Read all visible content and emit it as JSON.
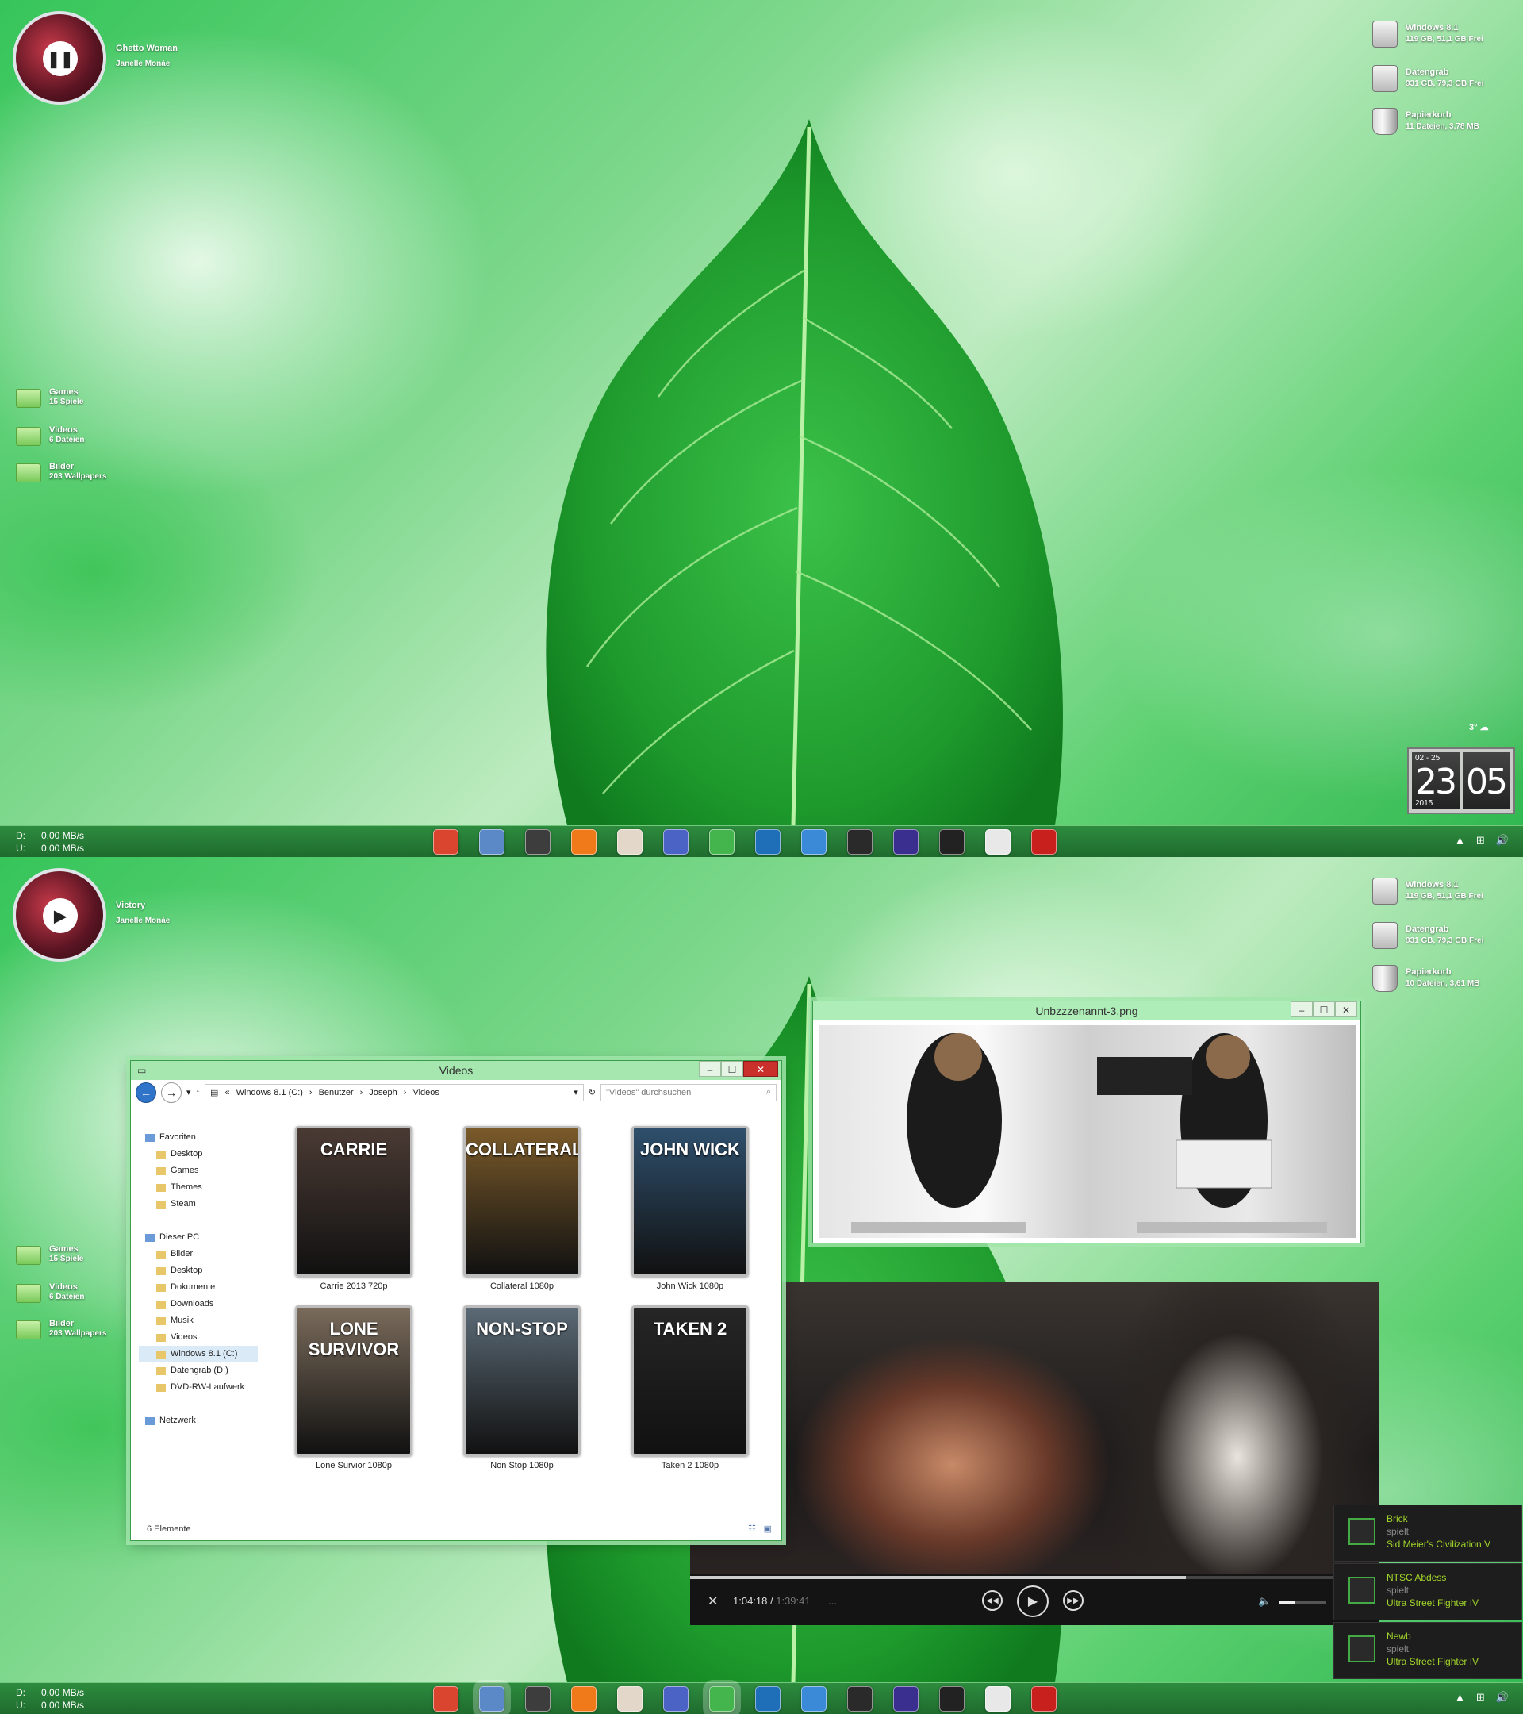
{
  "screen1": {
    "player": {
      "title": "Ghetto Woman",
      "artist": "Janelle Monáe",
      "state_icon": "pause-icon"
    },
    "drives": [
      {
        "name": "Windows 8.1",
        "info": "119 GB, 51,1 GB Frei"
      },
      {
        "name": "Datengrab",
        "info": "931 GB, 79,3 GB Frei"
      },
      {
        "name": "Papierkorb",
        "info": "11 Dateien, 3,78 MB"
      }
    ],
    "folders": [
      {
        "name": "Games",
        "info": "15 Spiele"
      },
      {
        "name": "Videos",
        "info": "6 Dateien"
      },
      {
        "name": "Bilder",
        "info": "203 Wallpapers"
      }
    ],
    "weather": "3°",
    "clock": {
      "date": "02 - 25",
      "year": "2015",
      "hour": "23",
      "minute": "05"
    },
    "net": {
      "d_label": "D:",
      "d_value": "0,00 MB/s",
      "u_label": "U:",
      "u_value": "0,00 MB/s"
    }
  },
  "screen2": {
    "player": {
      "title": "Victory",
      "artist": "Janelle Monáe",
      "state_icon": "play-icon"
    },
    "drives": [
      {
        "name": "Windows 8.1",
        "info": "119 GB, 51,1 GB Frei"
      },
      {
        "name": "Datengrab",
        "info": "931 GB, 79,3 GB Frei"
      },
      {
        "name": "Papierkorb",
        "info": "10 Dateien, 3,61 MB"
      }
    ],
    "folders": [
      {
        "name": "Games",
        "info": "15 Spiele"
      },
      {
        "name": "Videos",
        "info": "6 Dateien"
      },
      {
        "name": "Bilder",
        "info": "203 Wallpapers"
      }
    ],
    "net": {
      "d_label": "D:",
      "d_value": "0,00 MB/s",
      "u_label": "U:",
      "u_value": "0,00 MB/s"
    },
    "explorer": {
      "title": "Videos",
      "path": [
        "Windows 8.1 (C:)",
        "Benutzer",
        "Joseph",
        "Videos"
      ],
      "search_placeholder": "\"Videos\" durchsuchen",
      "nav": [
        {
          "label": "Favoriten",
          "level": 0
        },
        {
          "label": "Desktop",
          "level": 1
        },
        {
          "label": "Games",
          "level": 1
        },
        {
          "label": "Themes",
          "level": 1
        },
        {
          "label": "Steam",
          "level": 1
        },
        {
          "label": "",
          "level": 0
        },
        {
          "label": "Dieser PC",
          "level": 0
        },
        {
          "label": "Bilder",
          "level": 1
        },
        {
          "label": "Desktop",
          "level": 1
        },
        {
          "label": "Dokumente",
          "level": 1
        },
        {
          "label": "Downloads",
          "level": 1
        },
        {
          "label": "Musik",
          "level": 1
        },
        {
          "label": "Videos",
          "level": 1
        },
        {
          "label": "Windows 8.1 (C:)",
          "level": 1
        },
        {
          "label": "Datengrab (D:)",
          "level": 1
        },
        {
          "label": "DVD-RW-Laufwerk",
          "level": 1
        },
        {
          "label": "",
          "level": 0
        },
        {
          "label": "Netzwerk",
          "level": 0
        }
      ],
      "items": [
        {
          "caption": "Carrie 2013 720p",
          "cover_title": "CARRIE",
          "color": "#4a3a34"
        },
        {
          "caption": "Collateral 1080p",
          "cover_title": "COLLATERAL",
          "color": "#7a5a2a"
        },
        {
          "caption": "John Wick 1080p",
          "cover_title": "JOHN WICK",
          "color": "#2e4f6c"
        },
        {
          "caption": "Lone Survior 1080p",
          "cover_title": "LONE SURVIVOR",
          "color": "#7a6b5b"
        },
        {
          "caption": "Non Stop 1080p",
          "cover_title": "NON-STOP",
          "color": "#5b6a76"
        },
        {
          "caption": "Taken 2 1080p",
          "cover_title": "TAKEN 2",
          "color": "#262626"
        }
      ],
      "status": "6 Elemente"
    },
    "viewer": {
      "title": "Unbzzzenannt-3.png"
    },
    "video": {
      "elapsed": "1:04:18",
      "total": "1:39:41",
      "more": "...",
      "progress": 0.72,
      "volume": 0.35
    },
    "notifications": [
      {
        "name": "Brick",
        "verb": "spielt",
        "game": "Sid Meier's Civilization V"
      },
      {
        "name": "NTSC Abdess",
        "verb": "spielt",
        "game": "Ultra Street Fighter IV"
      },
      {
        "name": "Newb",
        "verb": "spielt",
        "game": "Ultra Street Fighter IV"
      }
    ]
  },
  "dock": [
    {
      "name": "chrome",
      "color": "#d9452f"
    },
    {
      "name": "explorer",
      "color": "#5b89c8"
    },
    {
      "name": "steam",
      "color": "#3d3d3d"
    },
    {
      "name": "origin",
      "color": "#f07a1a"
    },
    {
      "name": "feather",
      "color": "#e2d7c9"
    },
    {
      "name": "picasa",
      "color": "#4b63c4"
    },
    {
      "name": "download",
      "color": "#43b54c"
    },
    {
      "name": "speedtest",
      "color": "#1f6fb8"
    },
    {
      "name": "itunes",
      "color": "#3b8ad8"
    },
    {
      "name": "puppet",
      "color": "#2a2a2a"
    },
    {
      "name": "film",
      "color": "#3a2f8f"
    },
    {
      "name": "clapper",
      "color": "#222222"
    },
    {
      "name": "flash-drive",
      "color": "#e8e8e8"
    },
    {
      "name": "gamepad",
      "color": "#c8211d"
    }
  ],
  "tray": {
    "items": [
      "▲",
      "⊞",
      "🔊"
    ]
  }
}
